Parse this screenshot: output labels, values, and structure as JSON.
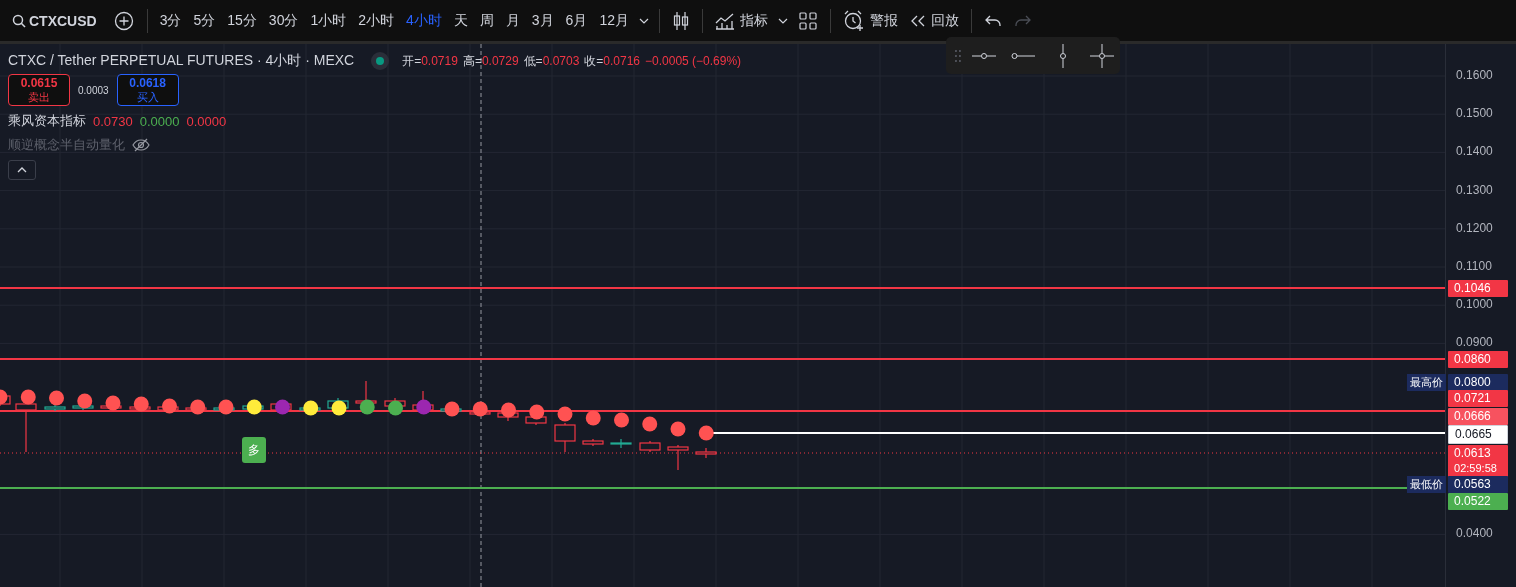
{
  "toolbar": {
    "symbol": "CTXCUSD",
    "intervals": [
      {
        "label": "3分",
        "selected": false
      },
      {
        "label": "5分",
        "selected": false
      },
      {
        "label": "15分",
        "selected": false
      },
      {
        "label": "30分",
        "selected": false
      },
      {
        "label": "1小时",
        "selected": false
      },
      {
        "label": "2小时",
        "selected": false
      },
      {
        "label": "4小时",
        "selected": true
      },
      {
        "label": "天",
        "selected": false
      },
      {
        "label": "周",
        "selected": false
      },
      {
        "label": "月",
        "selected": false
      },
      {
        "label": "3月",
        "selected": false
      },
      {
        "label": "6月",
        "selected": false
      },
      {
        "label": "12月",
        "selected": false
      }
    ],
    "indicators_label": "指标",
    "alert_label": "警报",
    "replay_label": "回放"
  },
  "legend": {
    "title": "CTXC / Tether PERPETUAL FUTURES · 4小时 · MEXC",
    "ohlc": [
      {
        "label": "开=",
        "value": "0.0719"
      },
      {
        "label": "高=",
        "value": "0.0729"
      },
      {
        "label": "低=",
        "value": "0.0703"
      },
      {
        "label": "收=",
        "value": "0.0716"
      }
    ],
    "change": "−0.0005 (−0.69%)"
  },
  "trade": {
    "sell_price": "0.0615",
    "sell_label": "卖出",
    "spread": "0.0003",
    "buy_price": "0.0618",
    "buy_label": "买入"
  },
  "indicators": [
    {
      "name": "乘风资本指标",
      "hidden": false,
      "values": [
        {
          "text": "0.0730",
          "color": "#f23645"
        },
        {
          "text": "0.0000",
          "color": "#4caf50"
        },
        {
          "text": "0.0000",
          "color": "#f23645"
        }
      ]
    },
    {
      "name": "顺逆概念半自动量化",
      "hidden": true
    }
  ],
  "price_axis": [
    "0.1600",
    "0.1500",
    "0.1400",
    "0.1300",
    "0.1200",
    "0.1100",
    "0.1000",
    "0.0900",
    "0.0400"
  ],
  "price_tags": [
    {
      "value": "0.1046",
      "color": "#f23645"
    },
    {
      "value": "0.0860",
      "color": "#f23645"
    },
    {
      "caption": "最高价",
      "value": "0.0800",
      "color": "#1c2b5e"
    },
    {
      "value": "0.0721",
      "color": "#f23645"
    },
    {
      "value": "0.0666",
      "color": "#f7525f"
    },
    {
      "value": "0.0665",
      "color": "#ffffff"
    },
    {
      "value": "0.0613",
      "countdown": "02:59:58",
      "color": "#f23645"
    },
    {
      "caption": "最低价",
      "value": "0.0563",
      "color": "#1c2b5e"
    },
    {
      "value": "0.0522",
      "color": "#4caf50"
    }
  ],
  "signal": "多"
}
